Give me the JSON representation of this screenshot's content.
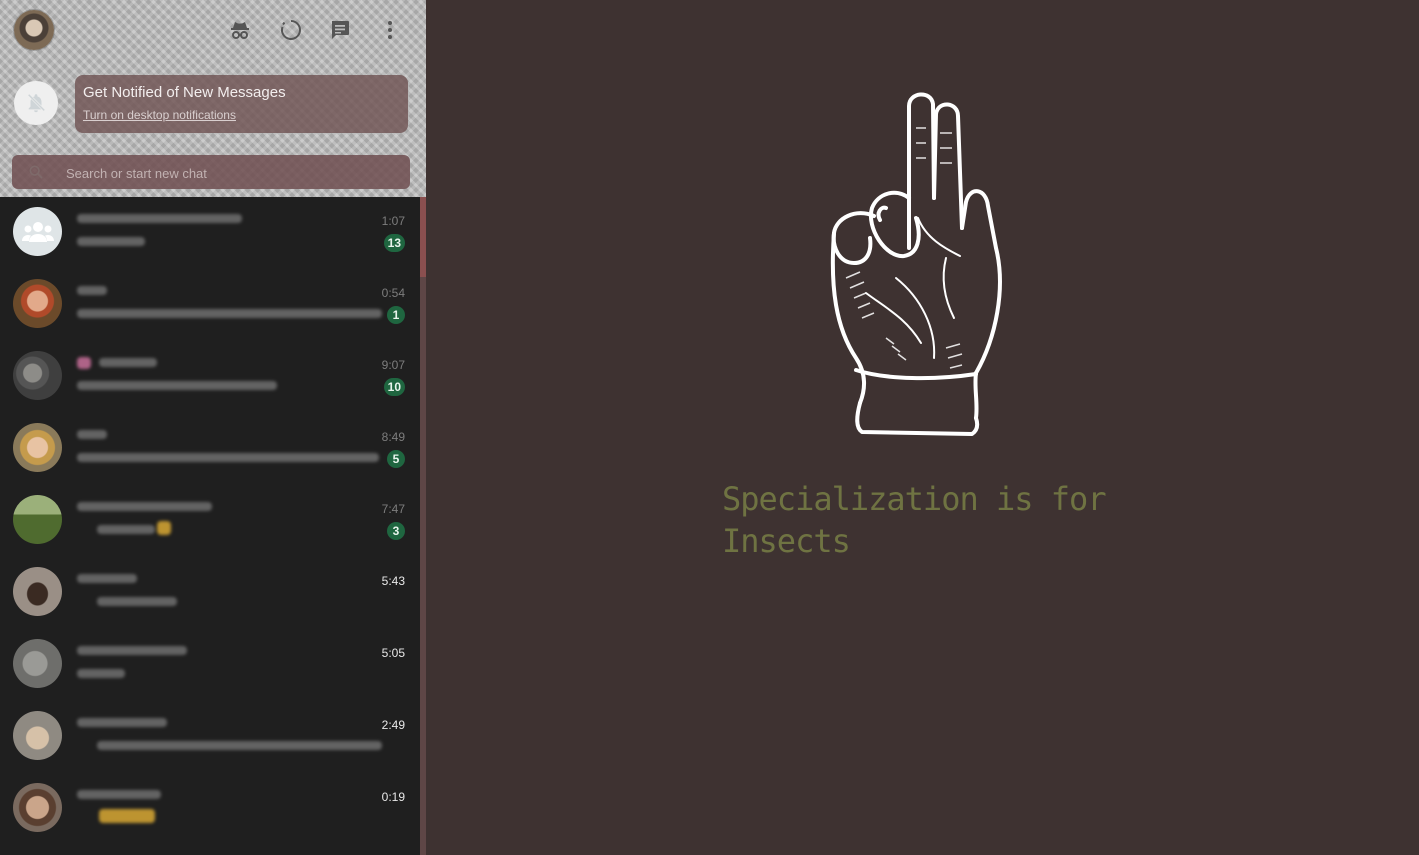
{
  "header": {
    "icons": [
      "profile-avatar",
      "incognito-icon",
      "status-icon",
      "new-chat-icon",
      "menu-icon"
    ]
  },
  "notification_banner": {
    "title": "Get Notified of New Messages",
    "link": "Turn on desktop notifications",
    "icon": "bell-off-icon"
  },
  "search": {
    "placeholder": "Search or start new chat",
    "value": ""
  },
  "chats": [
    {
      "time": "1:07",
      "unread": "13",
      "avatar": "group-icon"
    },
    {
      "time": "0:54",
      "unread": "1"
    },
    {
      "time": "9:07",
      "unread": "10"
    },
    {
      "time": "8:49",
      "unread": "5"
    },
    {
      "time": "7:47",
      "unread": "3"
    },
    {
      "time": "5:43"
    },
    {
      "time": "5:05"
    },
    {
      "time": "2:49"
    },
    {
      "time": "0:19"
    }
  ],
  "main": {
    "tagline": "Specialization is for Insects",
    "illustration": "hand-gesture-icon"
  },
  "colors": {
    "sidebar_bg": "#1f1f1f",
    "main_bg": "#3e3231",
    "badge": "#1f6640",
    "tagline": "#6f7342"
  }
}
